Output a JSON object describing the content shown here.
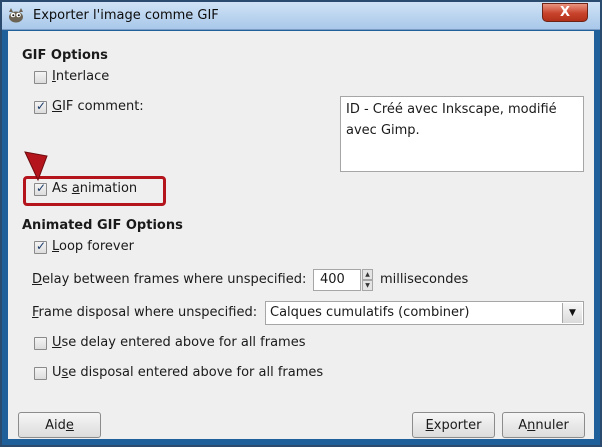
{
  "window": {
    "title": "Exporter l'image comme GIF",
    "close_glyph": "X",
    "app_icon": "gimp-wilber-icon"
  },
  "gif_options": {
    "heading": "GIF Options",
    "interlace": {
      "label_pre": "",
      "label_u": "I",
      "label_post": "nterlace",
      "checked": false
    },
    "gif_comment": {
      "label_pre": "",
      "label_u": "G",
      "label_post": "IF comment:",
      "checked": true,
      "value": "ID - Créé avec Inkscape, modifié avec Gimp."
    },
    "as_animation": {
      "label_pre": "As ",
      "label_u": "a",
      "label_post": "nimation",
      "checked": true
    }
  },
  "animated_options": {
    "heading": "Animated GIF Options",
    "loop_forever": {
      "label_pre": "",
      "label_u": "L",
      "label_post": "oop forever",
      "checked": true
    },
    "delay": {
      "label_pre": "",
      "label_u": "D",
      "label_post": "elay between frames where unspecified:",
      "value": "400",
      "unit": "millisecondes"
    },
    "disposal": {
      "label_pre": "",
      "label_u": "F",
      "label_post": "rame disposal where unspecified:",
      "value": "Calques cumulatifs (combiner)"
    },
    "use_delay": {
      "label_pre": "",
      "label_u": "U",
      "label_post": "se delay entered above for all frames",
      "checked": false
    },
    "use_disposal": {
      "label_pre": "U",
      "label_u": "s",
      "label_post": "e disposal entered above for all frames",
      "checked": false
    }
  },
  "buttons": {
    "help": {
      "pre": "Aid",
      "u": "e",
      "post": ""
    },
    "export": {
      "pre": "",
      "u": "E",
      "post": "xporter"
    },
    "cancel": {
      "pre": "A",
      "u": "n",
      "post": "nuler"
    }
  },
  "colors": {
    "highlight": "#b4151c",
    "title_bar": "#a9c8ea",
    "close_button": "#c8432b"
  }
}
